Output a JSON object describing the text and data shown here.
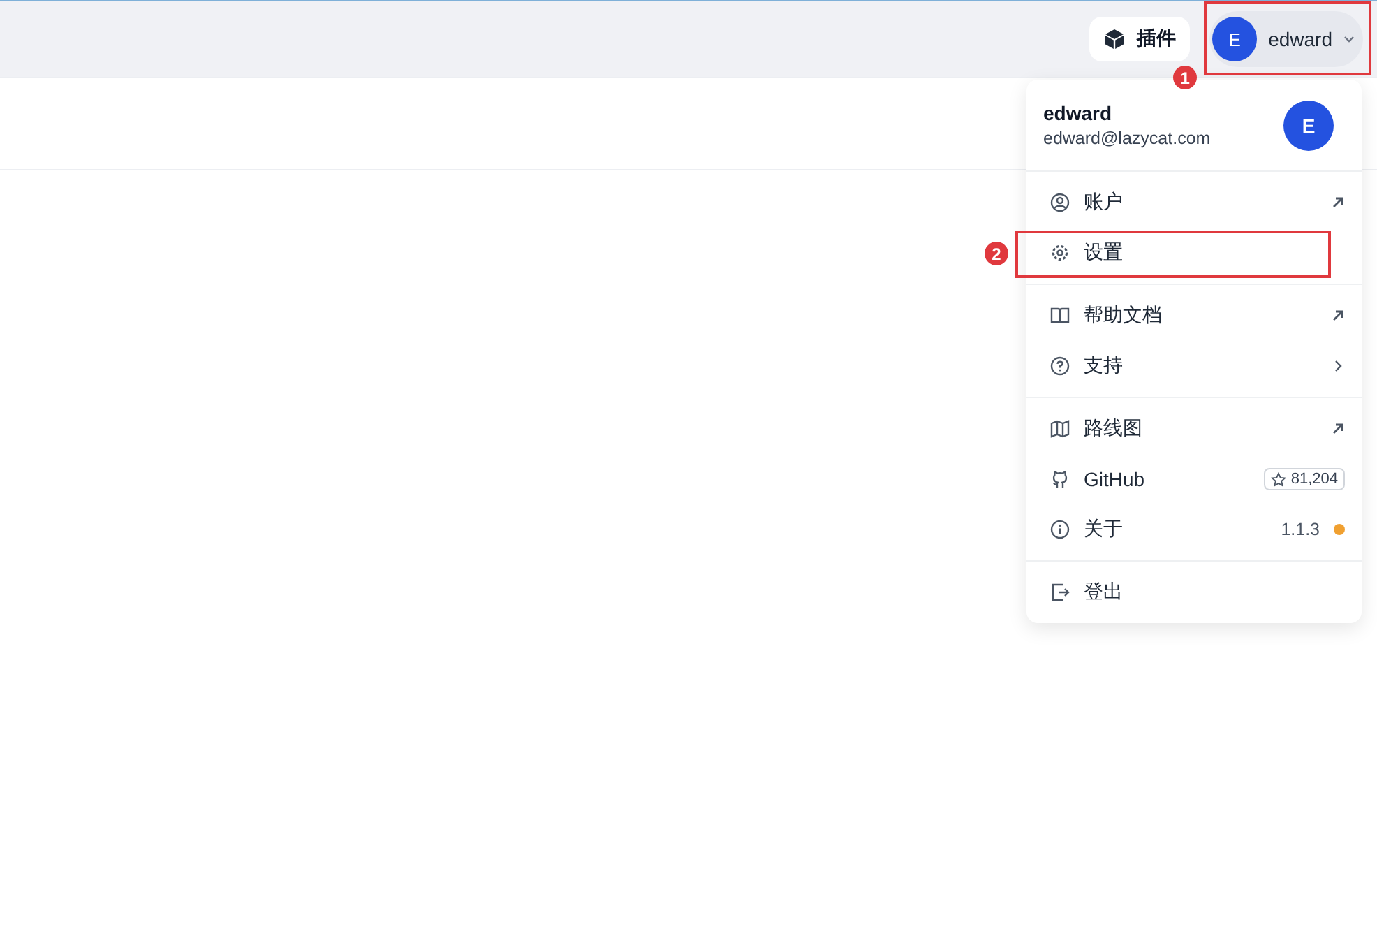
{
  "topbar": {
    "plugins_button": "插件",
    "user": {
      "avatar": "E",
      "name": "edward",
      "annotation": "1"
    }
  },
  "user_menu": {
    "header": {
      "name": "edward",
      "email": "edward@lazycat.com",
      "avatar": "E"
    },
    "sections": [
      [
        {
          "label": "账户",
          "kind": "external"
        },
        {
          "label": "设置",
          "kind": "plain",
          "annotation": "2"
        }
      ],
      [
        {
          "label": "帮助文档",
          "kind": "external"
        },
        {
          "label": "支持",
          "kind": "submenu"
        }
      ],
      [
        {
          "label": "路线图",
          "kind": "external"
        },
        {
          "label": "GitHub",
          "kind": "stars",
          "value": "81,204"
        },
        {
          "label": "关于",
          "kind": "version",
          "value": "1.1.3",
          "color": "#f0a030"
        }
      ],
      [
        {
          "label": "登出",
          "kind": "plain"
        }
      ]
    ]
  }
}
